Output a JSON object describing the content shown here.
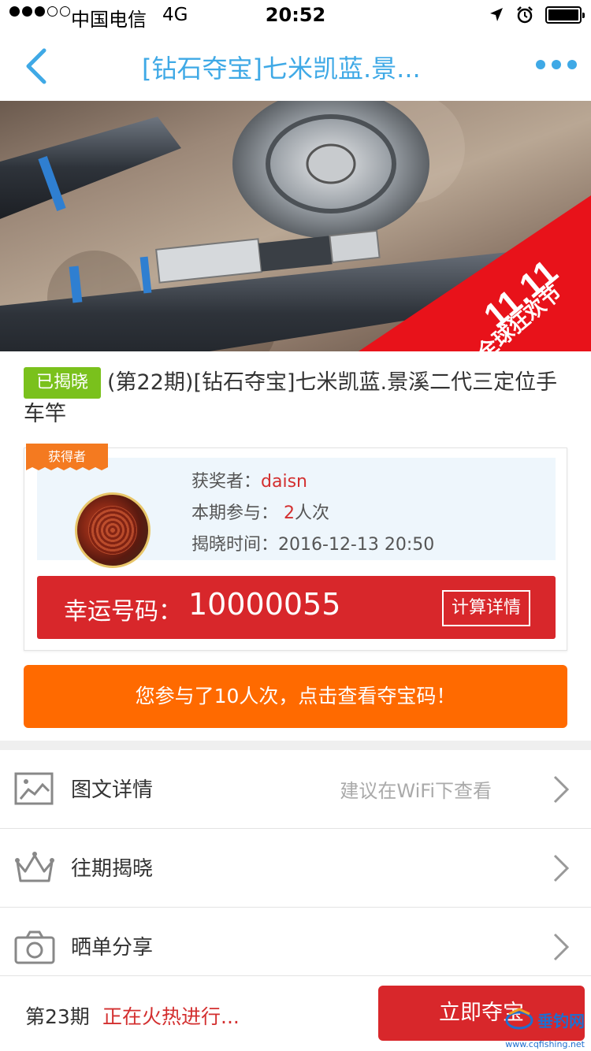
{
  "status_bar": {
    "carrier": "中国电信",
    "network": "4G",
    "time": "20:52"
  },
  "nav": {
    "title": "[钻石夺宝]七米凯蓝.景..."
  },
  "hero": {
    "badge_line1": "11.11",
    "badge_line2": "全球狂欢节"
  },
  "product": {
    "badge": "已揭晓",
    "title": "(第22期)[钻石夺宝]七米凯蓝.景溪二代三定位手车竿"
  },
  "winner": {
    "ribbon": "获得者",
    "winner_label": "获奖者：",
    "winner_name": "daisn",
    "participation_label": "本期参与：",
    "participation_count": "2",
    "participation_unit": "人次",
    "reveal_label": "揭晓时间：",
    "reveal_time": "2016-12-13 20:50",
    "lucky_label": "幸运号码：",
    "lucky_number": "10000055",
    "calc_button": "计算详情"
  },
  "cta": {
    "view_codes": "您参与了10人次，点击查看夺宝码！"
  },
  "rows": [
    {
      "label": "图文详情",
      "hint": "建议在WiFi下查看",
      "icon": "image-icon"
    },
    {
      "label": "往期揭晓",
      "hint": "",
      "icon": "crown-icon"
    },
    {
      "label": "晒单分享",
      "hint": "",
      "icon": "camera-icon"
    }
  ],
  "bottom": {
    "period": "第23期",
    "status": "正在火热进行...",
    "join_button": "立即夺宝",
    "watermark_text": "垂钓网",
    "watermark_url": "www.cqfishing.net"
  },
  "colors": {
    "accent_blue": "#3fa9e6",
    "red": "#d8272b",
    "orange": "#ff6a00",
    "green_badge": "#7ac11c"
  }
}
